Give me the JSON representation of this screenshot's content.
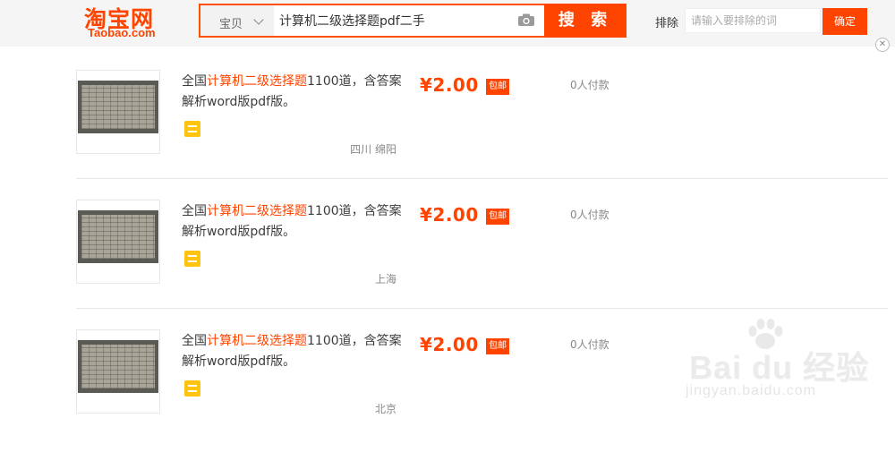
{
  "header": {
    "logo_cn": "淘宝网",
    "logo_en": "Taobao.com",
    "search_type": "宝贝",
    "search_query": "计算机二级选择题pdf二手",
    "search_button": "搜 索",
    "exclude_label": "排除",
    "exclude_placeholder": "请输入要排除的词",
    "exclude_button": "确定",
    "accent_color": "#ff4400"
  },
  "results": [
    {
      "title_prefix": "全国",
      "title_highlight": "计算机二级选择题",
      "title_suffix": "1100道，含答案解析word版pdf版。",
      "price": "¥2.00",
      "badge": "包邮",
      "paid_count": "0人付款",
      "location": "四川 绵阳"
    },
    {
      "title_prefix": "全国",
      "title_highlight": "计算机二级选择题",
      "title_suffix": "1100道，含答案解析word版pdf版。",
      "price": "¥2.00",
      "badge": "包邮",
      "paid_count": "0人付款",
      "location": "上海"
    },
    {
      "title_prefix": "全国",
      "title_highlight": "计算机二级选择题",
      "title_suffix": "1100道，含答案解析word版pdf版。",
      "price": "¥2.00",
      "badge": "包邮",
      "paid_count": "0人付款",
      "location": "北京"
    }
  ],
  "watermark": {
    "text": "Bai du 经验",
    "url": "jingyan.baidu.com"
  }
}
